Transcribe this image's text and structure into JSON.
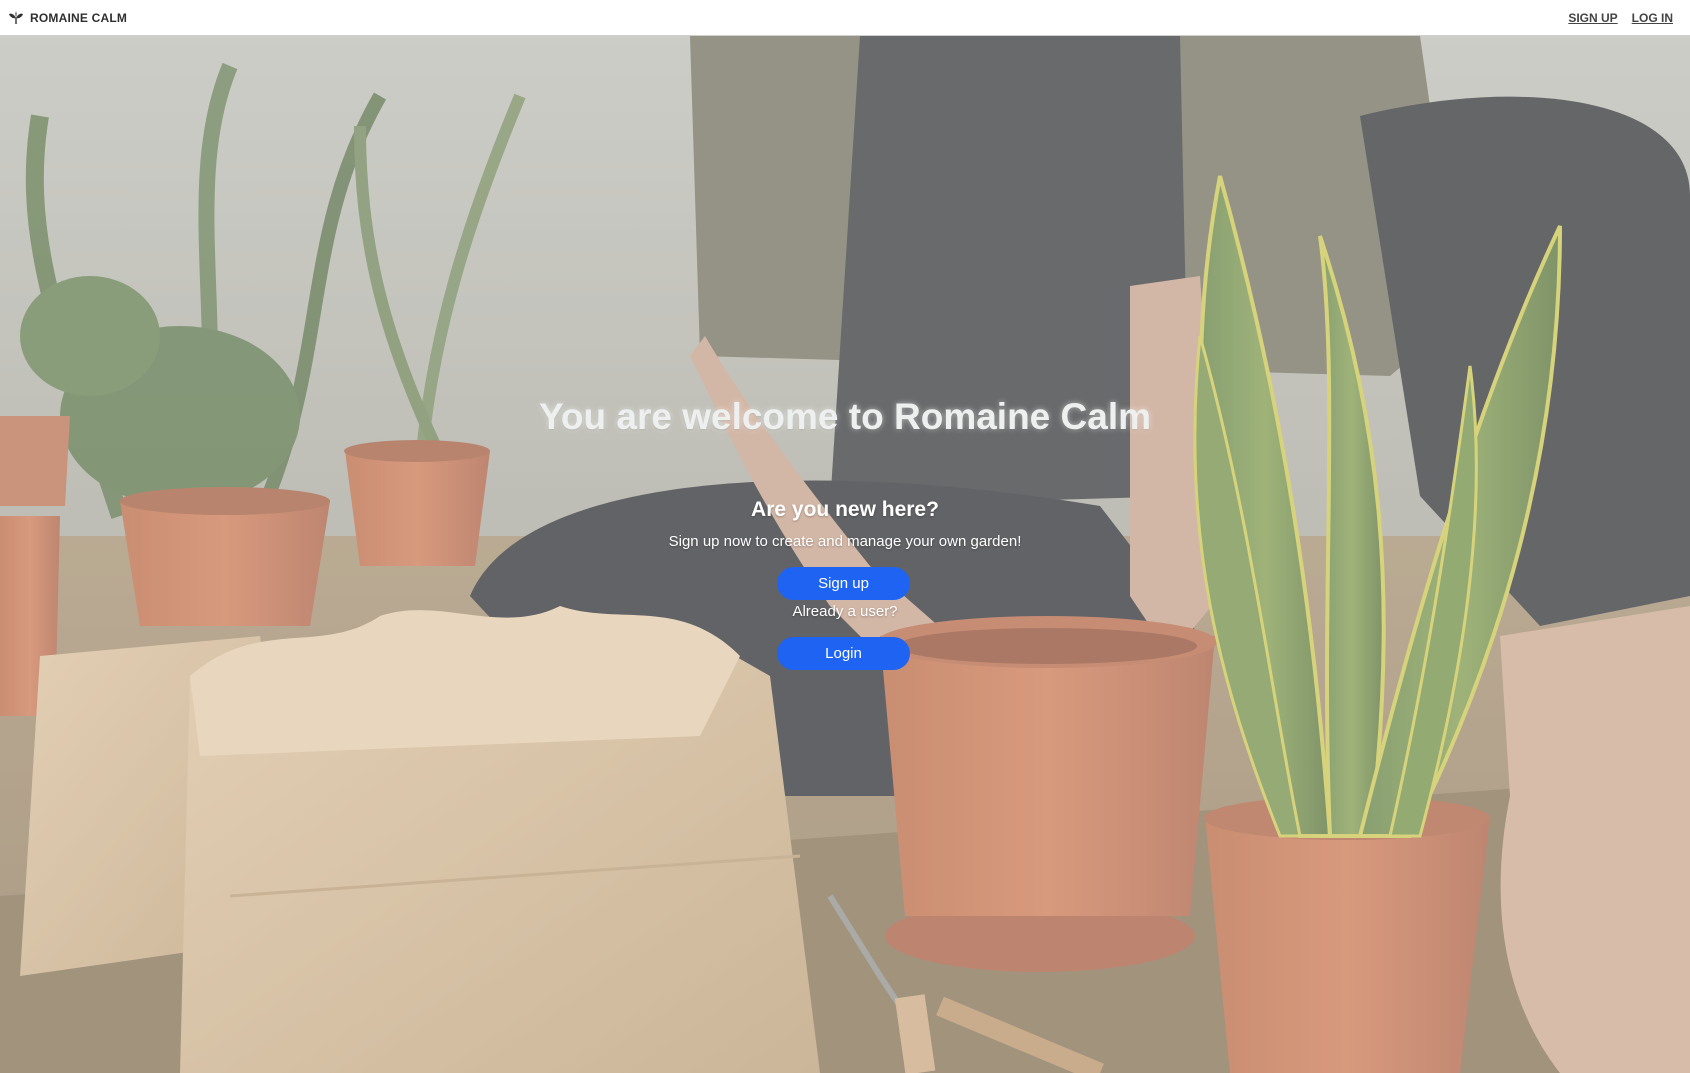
{
  "navbar": {
    "brand_icon": "leaf-sprout-icon",
    "brand_text": "ROMAINE CALM",
    "links": {
      "sign_up": "SIGN UP",
      "log_in": "LOG IN"
    }
  },
  "hero": {
    "title": "You are welcome to Romaine Calm",
    "subtitle": "Are you new here?",
    "description": "Sign up now to create and manage your own garden!",
    "signup_button": "Sign up",
    "already_text": "Already a user?",
    "login_button": "Login"
  },
  "colors": {
    "button_bg": "#1f63f2",
    "navbar_bg": "#ffffff",
    "hero_overlay": "rgba(255,255,255,0.28)"
  }
}
